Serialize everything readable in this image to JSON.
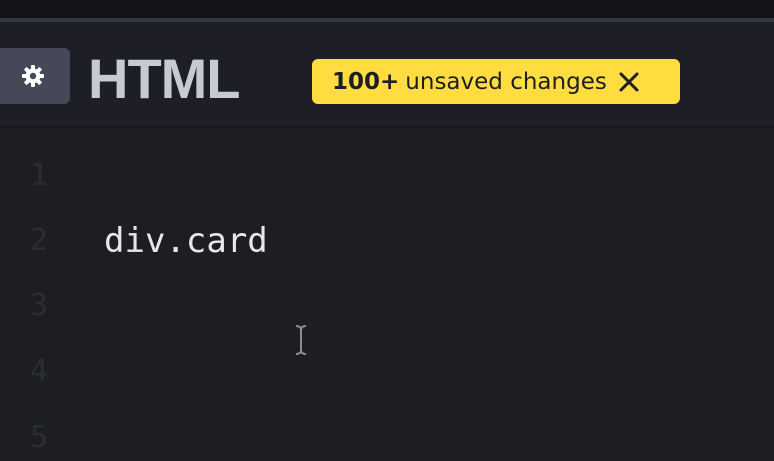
{
  "header": {
    "title": "HTML",
    "settings_icon": "gear-icon",
    "unsaved_badge": {
      "count": "100+",
      "text": "unsaved changes",
      "close_icon": "close-icon",
      "background": "#ffdd40"
    }
  },
  "editor": {
    "line_numbers": [
      "1",
      "2",
      "3",
      "4",
      "5"
    ],
    "lines": [
      "",
      "div.card",
      "",
      "",
      ""
    ]
  },
  "colors": {
    "background": "#1d1e22",
    "header_background": "#1e1f26",
    "title": "#c7c9d3",
    "button": "#444857",
    "badge": "#ffdd40"
  }
}
